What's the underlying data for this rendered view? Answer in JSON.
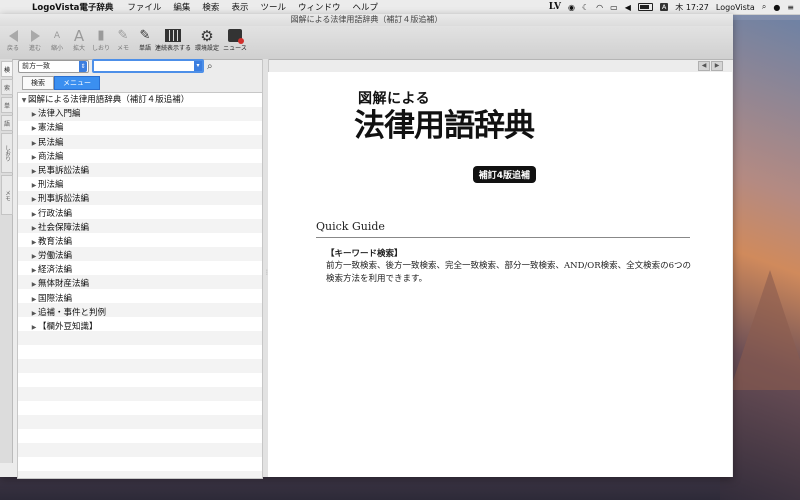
{
  "menubar": {
    "app_name": "LogoVista電子辞典",
    "items": [
      "ファイル",
      "編集",
      "検索",
      "表示",
      "ツール",
      "ウィンドウ",
      "ヘルプ"
    ],
    "status": {
      "lv": "LV",
      "a_badge": "A",
      "clock": "木 17:27",
      "user": "LogoVista"
    }
  },
  "window": {
    "title": "図解による法律用語辞典（補訂４版追補）"
  },
  "toolbar": {
    "back": "戻る",
    "forward": "進む",
    "shrink": "縮小",
    "enlarge": "拡大",
    "bookmark": "しおり",
    "memo": "メモ",
    "wordbook": "単語",
    "continuous": "連続表示する",
    "settings": "環境設定",
    "news": "ニュース"
  },
  "left_tabs": [
    "検",
    "索",
    "単",
    "語",
    "しおり",
    "メモ"
  ],
  "search": {
    "mode": "前方一致",
    "query": "",
    "tabs": [
      "検索",
      "メニュー"
    ],
    "active_tab": "メニュー"
  },
  "tree": {
    "root": "図解による法律用語辞典（補訂４版追補）",
    "items": [
      "法律入門編",
      "憲法編",
      "民法編",
      "商法編",
      "民事訴訟法編",
      "刑法編",
      "刑事訴訟法編",
      "行政法編",
      "社会保障法編",
      "教育法編",
      "労働法編",
      "経済法編",
      "無体財産法編",
      "国際法編",
      "追補・事件と判例",
      "【欄外豆知識】"
    ]
  },
  "content": {
    "title_small": "図解による",
    "title_big": "法律用語辞典",
    "title_badge": "補訂4版追補",
    "quick_guide": "Quick Guide",
    "keyword_heading": "【キーワード検索】",
    "keyword_body": "前方一致検索、後方一致検索、完全一致検索、部分一致検索、AND/OR検索、全文検索の6つの検索方法を利用できます。"
  },
  "colors": {
    "accent": "#3b8ff0",
    "window_bg": "#ececec",
    "content_bg": "#ffffff"
  }
}
